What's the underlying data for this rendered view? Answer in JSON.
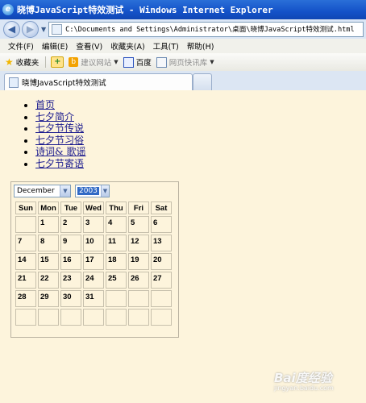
{
  "window": {
    "title": "晓博JavaScript特效测试 - Windows Internet Explorer"
  },
  "address_bar": {
    "url": "C:\\Documents and Settings\\Administrator\\桌面\\晓博JavaScript特效测试.html"
  },
  "menu": [
    "文件(F)",
    "编辑(E)",
    "查看(V)",
    "收藏夹(A)",
    "工具(T)",
    "帮助(H)"
  ],
  "favorites_bar": {
    "favorites_label": "收藏夹",
    "suggested_sites": "建议网站",
    "baidu": "百度",
    "web_slice": "网页快讯库"
  },
  "tab": {
    "title": "晓博JavaScript特效测试"
  },
  "nav_links": [
    "首页",
    "七夕简介",
    "七夕节传说",
    "七夕节习俗",
    "诗词& 歌谣",
    "七夕节寄语"
  ],
  "calendar": {
    "month": "December",
    "year": "2003",
    "weekdays": [
      "Sun",
      "Mon",
      "Tue",
      "Wed",
      "Thu",
      "Fri",
      "Sat"
    ],
    "weeks": [
      [
        "",
        "1",
        "2",
        "3",
        "4",
        "5",
        "6"
      ],
      [
        "7",
        "8",
        "9",
        "10",
        "11",
        "12",
        "13"
      ],
      [
        "14",
        "15",
        "16",
        "17",
        "18",
        "19",
        "20"
      ],
      [
        "21",
        "22",
        "23",
        "24",
        "25",
        "26",
        "27"
      ],
      [
        "28",
        "29",
        "30",
        "31",
        "",
        "",
        ""
      ],
      [
        "",
        "",
        "",
        "",
        "",
        "",
        ""
      ]
    ]
  },
  "watermark": {
    "main": "Bai度经验",
    "sub": "jingyan.baidu.com"
  },
  "colors": {
    "titlebar": "#1452c8",
    "page_background": "#fdf4dc",
    "link": "#1a1a8e",
    "selection": "#316ac5"
  }
}
